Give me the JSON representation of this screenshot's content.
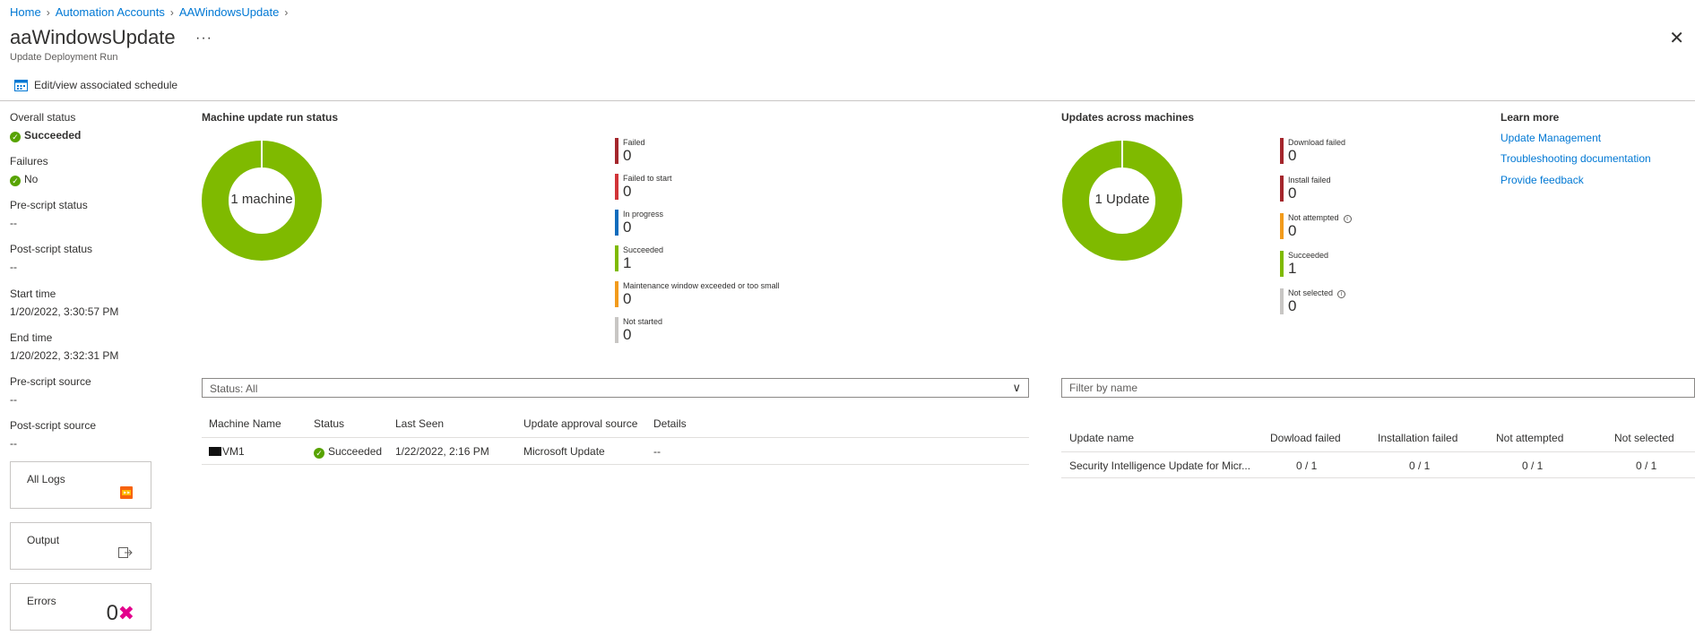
{
  "breadcrumb": [
    {
      "label": "Home"
    },
    {
      "label": "Automation Accounts"
    },
    {
      "label": "AAWindowsUpdate"
    }
  ],
  "header": {
    "title": "aaWindowsUpdate",
    "subtitle": "Update Deployment Run",
    "more": "···",
    "close": "✕"
  },
  "toolbar": {
    "schedule_label": "Edit/view associated schedule"
  },
  "details": {
    "overall_status_label": "Overall status",
    "overall_status_value": "Succeeded",
    "failures_label": "Failures",
    "failures_value": "No",
    "prescript_status_label": "Pre-script status",
    "prescript_status_value": "--",
    "postscript_status_label": "Post-script status",
    "postscript_status_value": "--",
    "start_time_label": "Start time",
    "start_time_value": "1/20/2022, 3:30:57 PM",
    "end_time_label": "End time",
    "end_time_value": "1/20/2022, 3:32:31 PM",
    "prescript_source_label": "Pre-script source",
    "prescript_source_value": "--",
    "postscript_source_label": "Post-script source",
    "postscript_source_value": "--"
  },
  "tiles": {
    "all_logs": "All Logs",
    "output": "Output",
    "errors": "Errors",
    "errors_count": "0"
  },
  "machine_status": {
    "title": "Machine update run status",
    "center": "1 machine",
    "legend": [
      {
        "label": "Failed",
        "value": "0",
        "color": "#a4262c"
      },
      {
        "label": "Failed to start",
        "value": "0",
        "color": "#d13438"
      },
      {
        "label": "In progress",
        "value": "0",
        "color": "#0f6cbd"
      },
      {
        "label": "Succeeded",
        "value": "1",
        "color": "#7fba00"
      },
      {
        "label": "Maintenance window exceeded or too small",
        "value": "0",
        "color": "#f29b1c"
      },
      {
        "label": "Not started",
        "value": "0",
        "color": "#c8c6c4"
      }
    ]
  },
  "updates_status": {
    "title": "Updates across machines",
    "center": "1 Update",
    "legend": [
      {
        "label": "Download failed",
        "value": "0",
        "color": "#a4262c"
      },
      {
        "label": "Install failed",
        "value": "0",
        "color": "#a4262c"
      },
      {
        "label": "Not attempted",
        "value": "0",
        "color": "#f29b1c",
        "info": true
      },
      {
        "label": "Succeeded",
        "value": "1",
        "color": "#7fba00"
      },
      {
        "label": "Not selected",
        "value": "0",
        "color": "#c8c6c4",
        "info": true
      }
    ]
  },
  "learn_more": {
    "title": "Learn more",
    "links": [
      "Update Management",
      "Troubleshooting documentation",
      "Provide feedback"
    ]
  },
  "machine_table": {
    "filter_label": "Status: All",
    "columns": [
      "Machine Name",
      "Status",
      "Last Seen",
      "Update approval source",
      "Details"
    ],
    "rows": [
      {
        "name": "VM1",
        "status": "Succeeded",
        "last_seen": "1/22/2022, 2:16 PM",
        "source": "Microsoft Update",
        "details": "--"
      }
    ]
  },
  "update_table": {
    "filter_placeholder": "Filter by name",
    "columns": [
      "Update name",
      "Dowload failed",
      "Installation failed",
      "Not attempted",
      "Not selected"
    ],
    "rows": [
      {
        "name": "Security Intelligence Update for Micr...",
        "download_failed": "0 / 1",
        "install_failed": "0 / 1",
        "not_attempted": "0 / 1",
        "not_selected": "0 / 1"
      }
    ]
  },
  "colors": {
    "accent": "#0078d4",
    "success": "#57a300",
    "donut": "#7fba00",
    "error_x": "#e3008c"
  }
}
